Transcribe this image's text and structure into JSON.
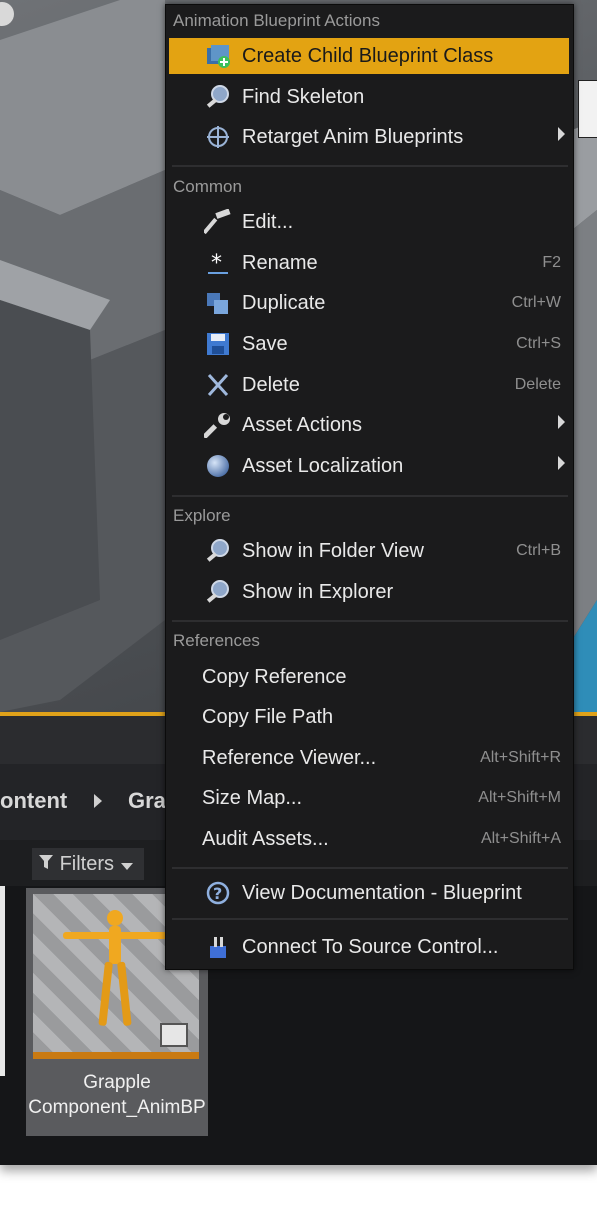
{
  "breadcrumb": {
    "segments": [
      "ontent",
      "Gra"
    ],
    "chevron_icon": "chevron-right-icon"
  },
  "filters": {
    "label": "Filters",
    "icon": "filter-icon"
  },
  "asset": {
    "name": "Grapple Component_AnimBP",
    "type_icon": "anim-blueprint-icon",
    "thumbnail_icon": "mannequin-icon"
  },
  "context_menu": {
    "sections": [
      {
        "header": "Animation Blueprint Actions",
        "items": [
          {
            "label": "Create Child Blueprint Class",
            "shortcut": "",
            "icon": "create-blueprint-icon",
            "highlighted": true
          },
          {
            "label": "Find Skeleton",
            "shortcut": "",
            "icon": "magnifier-icon"
          },
          {
            "label": "Retarget Anim Blueprints",
            "shortcut": "",
            "icon": "retarget-icon",
            "submenu": true
          }
        ]
      },
      {
        "header": "Common",
        "items": [
          {
            "label": "Edit...",
            "shortcut": "",
            "icon": "hammer-icon"
          },
          {
            "label": "Rename",
            "shortcut": "F2",
            "icon": "rename-icon"
          },
          {
            "label": "Duplicate",
            "shortcut": "Ctrl+W",
            "icon": "duplicate-icon"
          },
          {
            "label": "Save",
            "shortcut": "Ctrl+S",
            "icon": "save-icon"
          },
          {
            "label": "Delete",
            "shortcut": "Delete",
            "icon": "delete-icon"
          },
          {
            "label": "Asset Actions",
            "shortcut": "",
            "icon": "wrench-icon",
            "submenu": true
          },
          {
            "label": "Asset Localization",
            "shortcut": "",
            "icon": "globe-icon",
            "submenu": true
          }
        ]
      },
      {
        "header": "Explore",
        "items": [
          {
            "label": "Show in Folder View",
            "shortcut": "Ctrl+B",
            "icon": "magnifier-icon"
          },
          {
            "label": "Show in Explorer",
            "shortcut": "",
            "icon": "magnifier-icon"
          }
        ]
      },
      {
        "header": "References",
        "items": [
          {
            "label": "Copy Reference",
            "shortcut": ""
          },
          {
            "label": "Copy File Path",
            "shortcut": ""
          },
          {
            "label": "Reference Viewer...",
            "shortcut": "Alt+Shift+R"
          },
          {
            "label": "Size Map...",
            "shortcut": "Alt+Shift+M"
          },
          {
            "label": "Audit Assets...",
            "shortcut": "Alt+Shift+A"
          }
        ]
      }
    ],
    "footer_items": [
      {
        "label": "View Documentation - Blueprint",
        "shortcut": "",
        "icon": "help-icon"
      },
      {
        "label": "Connect To Source Control...",
        "shortcut": "",
        "icon": "source-control-icon"
      }
    ]
  },
  "colors": {
    "highlight": "#e3a312",
    "menu_bg": "#1b1b1c",
    "accent_orange": "#e0a21a"
  }
}
